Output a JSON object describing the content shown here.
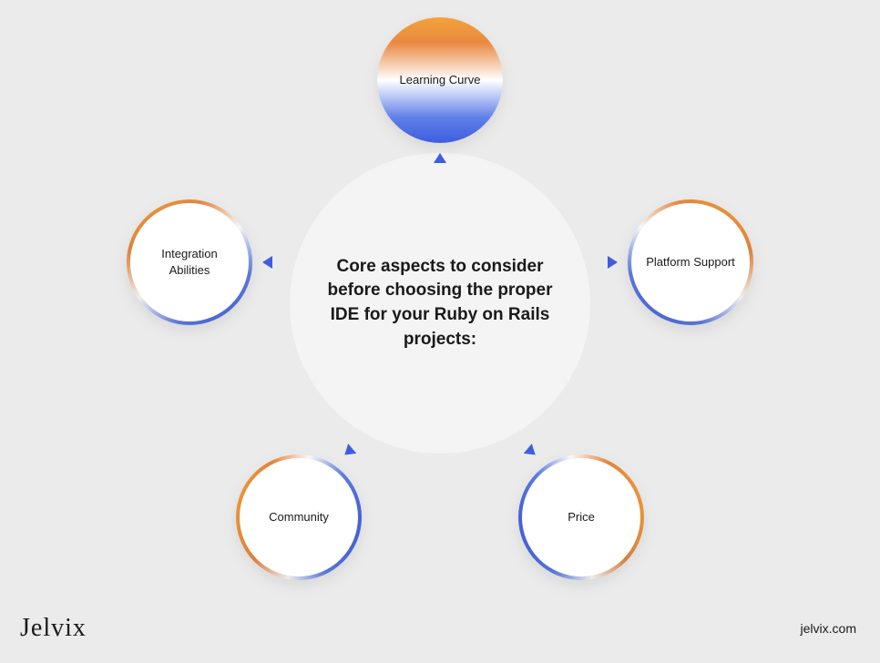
{
  "center_text": "Core aspects to consider before choosing the proper IDE for your Ruby on Rails projects:",
  "nodes": {
    "top": "Learning Curve",
    "right": "Platform Support",
    "bottom_right": "Price",
    "bottom_left": "Community",
    "left": "Integration Abilities"
  },
  "logo": "Jelvix",
  "site": "jelvix.com",
  "colors": {
    "accent_blue": "#3f5de0",
    "accent_orange": "#f2a33a",
    "background": "#ebebeb"
  }
}
